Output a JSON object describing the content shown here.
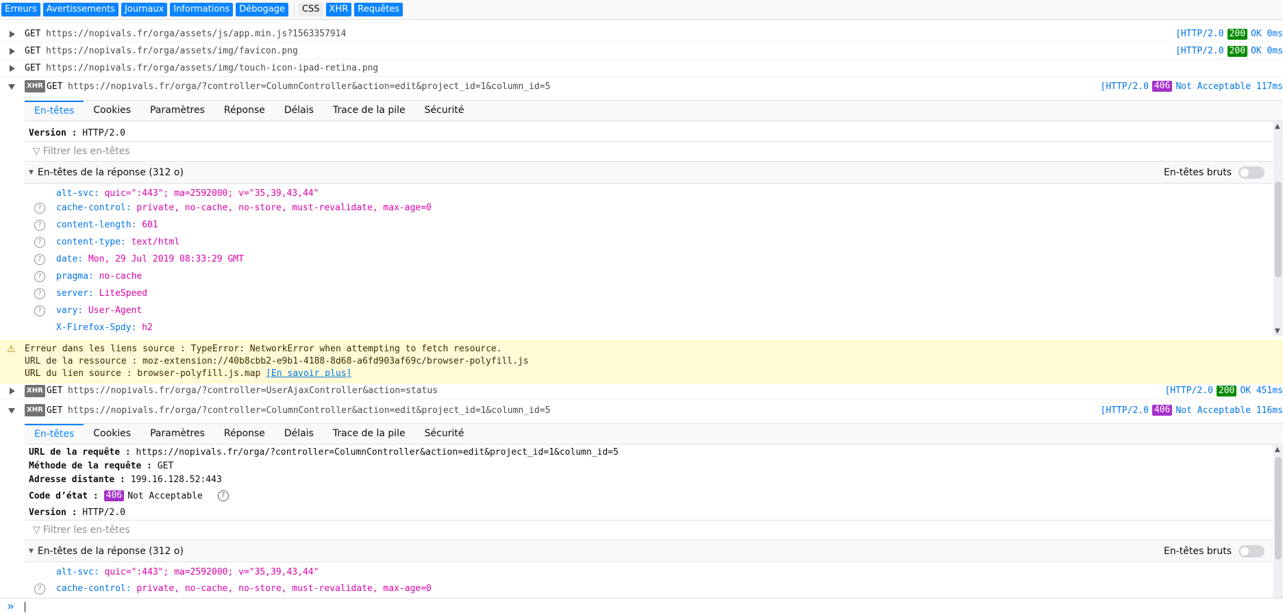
{
  "filter_bar": {
    "buttons": [
      "Erreurs",
      "Avertissements",
      "Journaux",
      "Informations",
      "Débogage"
    ],
    "buttons2": [
      "CSS",
      "XHR",
      "Requêtes"
    ]
  },
  "rows": [
    {
      "method": "GET",
      "url": "https://nopivals.fr/orga/assets/js/app.min.js?1563357914",
      "proto": "[HTTP/2.0",
      "code": "200",
      "status": "OK 0ms"
    },
    {
      "method": "GET",
      "url": "https://nopivals.fr/orga/assets/img/favicon.png",
      "proto": "[HTTP/2.0",
      "code": "200",
      "status": "OK 0ms"
    },
    {
      "method": "GET",
      "url": "https://nopivals.fr/orga/assets/img/touch-icon-ipad-retina.png"
    },
    {
      "badge": "XHR",
      "method": "GET",
      "url": "https://nopivals.fr/orga/?controller=ColumnController&action=edit&project_id=1&column_id=5",
      "proto": "[HTTP/2.0",
      "code": "406",
      "status": "Not Acceptable 117ms"
    },
    {
      "badge": "XHR",
      "method": "GET",
      "url": "https://nopivals.fr/orga/?controller=UserAjaxController&action=status",
      "proto": "[HTTP/2.0",
      "code": "200",
      "status": "OK 451ms"
    },
    {
      "badge": "XHR",
      "method": "GET",
      "url": "https://nopivals.fr/orga/?controller=ColumnController&action=edit&project_id=1&column_id=5",
      "proto": "[HTTP/2.0",
      "code": "406",
      "status": "Not Acceptable 116ms"
    }
  ],
  "tabs": [
    "En-têtes",
    "Cookies",
    "Paramètres",
    "Réponse",
    "Délais",
    "Trace de la pile",
    "Sécurité"
  ],
  "panel1": {
    "version_label": "Version :",
    "version_value": "HTTP/2.0",
    "filter_placeholder": "Filtrer les en-têtes",
    "section_title": "En-têtes de la réponse (312 o)",
    "raw_label": "En-têtes bruts",
    "headers": [
      {
        "name": "alt-svc:",
        "value": "quic=\":443\"; ma=2592000; v=\"35,39,43,44\""
      },
      {
        "name": "cache-control:",
        "value": "private, no-cache, no-store, must-revalidate, max-age=0"
      },
      {
        "name": "content-length:",
        "value": "601"
      },
      {
        "name": "content-type:",
        "value": "text/html"
      },
      {
        "name": "date:",
        "value": "Mon, 29 Jul 2019 08:33:29 GMT"
      },
      {
        "name": "pragma:",
        "value": "no-cache"
      },
      {
        "name": "server:",
        "value": "LiteSpeed"
      },
      {
        "name": "vary:",
        "value": "User-Agent"
      },
      {
        "name": "X-Firefox-Spdy:",
        "value": "h2"
      }
    ]
  },
  "warning": {
    "line1": "Erreur dans les liens source : TypeError: NetworkError when attempting to fetch resource.",
    "line2": "URL de la ressource : moz-extension://40b8cbb2-e9b1-4188-8d68-a6fd903af69c/browser-polyfill.js",
    "line3": "URL du lien source : browser-polyfill.js.map",
    "link": "[En savoir plus]"
  },
  "panel2": {
    "req_url_label": "URL de la requête :",
    "req_url_value": "https://nopivals.fr/orga/?controller=ColumnController&action=edit&project_id=1&column_id=5",
    "method_label": "Méthode de la requête :",
    "method_value": "GET",
    "remote_label": "Adresse distante :",
    "remote_value": "199.16.128.52:443",
    "status_label": "Code d’état :",
    "status_code": "406",
    "status_text": "Not Acceptable",
    "version_label": "Version :",
    "version_value": "HTTP/2.0",
    "filter_placeholder": "Filtrer les en-têtes",
    "section_title": "En-têtes de la réponse (312 o)",
    "raw_label": "En-têtes bruts",
    "headers": [
      {
        "name": "alt-svc:",
        "value": "quic=\":443\"; ma=2592000; v=\"35,39,43,44\""
      },
      {
        "name": "cache-control:",
        "value": "private, no-cache, no-store, must-revalidate, max-age=0"
      }
    ]
  },
  "colors": {
    "accent": "#0a84ff",
    "ok": "#058b00",
    "not_acceptable": "#a52fc9",
    "header_name": "#0074e8",
    "header_value": "#dd00a9",
    "warning_bg": "#fffbd6"
  }
}
